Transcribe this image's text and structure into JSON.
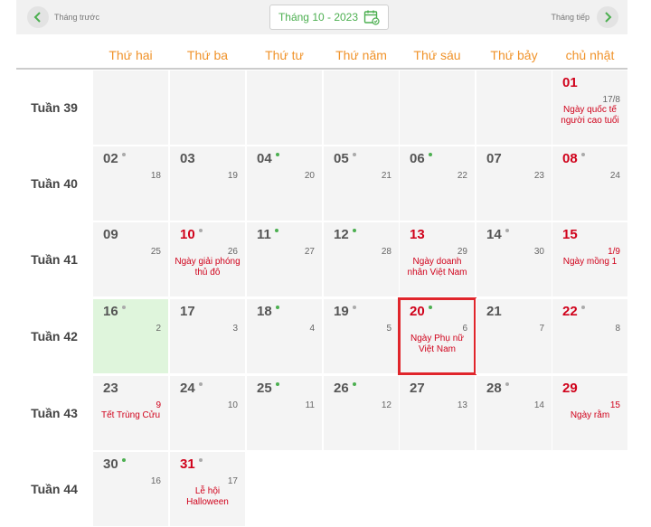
{
  "nav": {
    "prev_label": "Tháng trước",
    "next_label": "Tháng tiếp",
    "month_label": "Tháng 10 - 2023"
  },
  "weekdays": [
    "Thứ hai",
    "Thứ ba",
    "Thứ tư",
    "Thứ năm",
    "Thứ sáu",
    "Thứ bảy",
    "chủ nhật"
  ],
  "weeks": [
    {
      "label": "Tuần 39",
      "days": [
        null,
        null,
        null,
        null,
        null,
        null,
        {
          "day": "01",
          "lunar": "17/8",
          "red": true,
          "event": "Ngày quốc tế người cao tuổi",
          "dot": "none"
        }
      ]
    },
    {
      "label": "Tuần 40",
      "days": [
        {
          "day": "02",
          "lunar": "18",
          "dot": "gray"
        },
        {
          "day": "03",
          "lunar": "19",
          "dot": "none"
        },
        {
          "day": "04",
          "lunar": "20",
          "dot": "green"
        },
        {
          "day": "05",
          "lunar": "21",
          "dot": "gray"
        },
        {
          "day": "06",
          "lunar": "22",
          "dot": "green"
        },
        {
          "day": "07",
          "lunar": "23",
          "dot": "none"
        },
        {
          "day": "08",
          "lunar": "24",
          "dot": "gray",
          "red": true
        }
      ]
    },
    {
      "label": "Tuần 41",
      "days": [
        {
          "day": "09",
          "lunar": "25",
          "dot": "none"
        },
        {
          "day": "10",
          "lunar": "26",
          "dot": "gray",
          "red": true,
          "event": "Ngày giải phóng thủ đô"
        },
        {
          "day": "11",
          "lunar": "27",
          "dot": "green"
        },
        {
          "day": "12",
          "lunar": "28",
          "dot": "green"
        },
        {
          "day": "13",
          "lunar": "29",
          "dot": "none",
          "red": true,
          "event": "Ngày doanh nhân Việt Nam"
        },
        {
          "day": "14",
          "lunar": "30",
          "dot": "gray"
        },
        {
          "day": "15",
          "lunar": "1/9",
          "dot": "none",
          "red": true,
          "lunar_red": true,
          "event": "Ngày mồng 1"
        }
      ]
    },
    {
      "label": "Tuần 42",
      "days": [
        {
          "day": "16",
          "lunar": "2",
          "dot": "gray",
          "today": true
        },
        {
          "day": "17",
          "lunar": "3",
          "dot": "none"
        },
        {
          "day": "18",
          "lunar": "4",
          "dot": "green"
        },
        {
          "day": "19",
          "lunar": "5",
          "dot": "gray"
        },
        {
          "day": "20",
          "lunar": "6",
          "dot": "green",
          "red": true,
          "selected": true,
          "event": "Ngày Phụ nữ Việt Nam"
        },
        {
          "day": "21",
          "lunar": "7",
          "dot": "none"
        },
        {
          "day": "22",
          "lunar": "8",
          "dot": "gray",
          "red": true
        }
      ]
    },
    {
      "label": "Tuần 43",
      "days": [
        {
          "day": "23",
          "lunar": "9",
          "dot": "none",
          "lunar_red": true,
          "event": "Tết Trùng Cửu"
        },
        {
          "day": "24",
          "lunar": "10",
          "dot": "gray"
        },
        {
          "day": "25",
          "lunar": "11",
          "dot": "green"
        },
        {
          "day": "26",
          "lunar": "12",
          "dot": "green"
        },
        {
          "day": "27",
          "lunar": "13",
          "dot": "none"
        },
        {
          "day": "28",
          "lunar": "14",
          "dot": "gray"
        },
        {
          "day": "29",
          "lunar": "15",
          "dot": "none",
          "red": true,
          "lunar_red": true,
          "event": "Ngày rằm"
        }
      ]
    },
    {
      "label": "Tuần 44",
      "days": [
        {
          "day": "30",
          "lunar": "16",
          "dot": "green"
        },
        {
          "day": "31",
          "lunar": "17",
          "dot": "gray",
          "red": true,
          "event": "Lễ hội Halloween"
        },
        null,
        null,
        null,
        null,
        null
      ]
    }
  ]
}
